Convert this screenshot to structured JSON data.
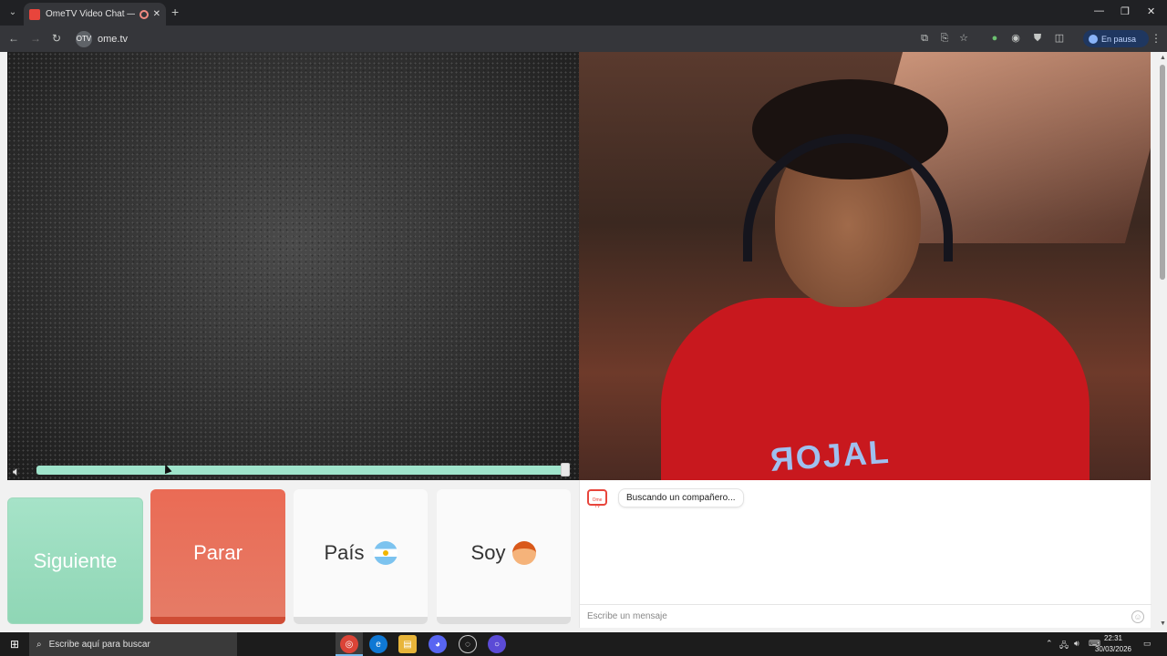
{
  "browser": {
    "tab_title": "OmeTV Video Chat — Om…",
    "tab_close": "✕",
    "new_tab": "+",
    "url": "ome.tv",
    "site_badge": "OTV",
    "pause_label": "En pausa"
  },
  "page": {
    "buttons": {
      "next": "Siguiente",
      "stop": "Parar",
      "country": "País",
      "gender": "Soy"
    },
    "chat": {
      "status_message": "Buscando un compañero...",
      "logo_text": "Ome TV",
      "input_placeholder": "Escribe un mensaje"
    },
    "video": {
      "shirt_print": "ЯOJAL"
    }
  },
  "taskbar": {
    "search_placeholder": "Escribe aquí para buscar",
    "time": "22:31",
    "date": "30/03/2026"
  },
  "colors": {
    "next": "#a6e3c8",
    "stop": "#ea6b55",
    "volume": "#9fe4cb"
  }
}
